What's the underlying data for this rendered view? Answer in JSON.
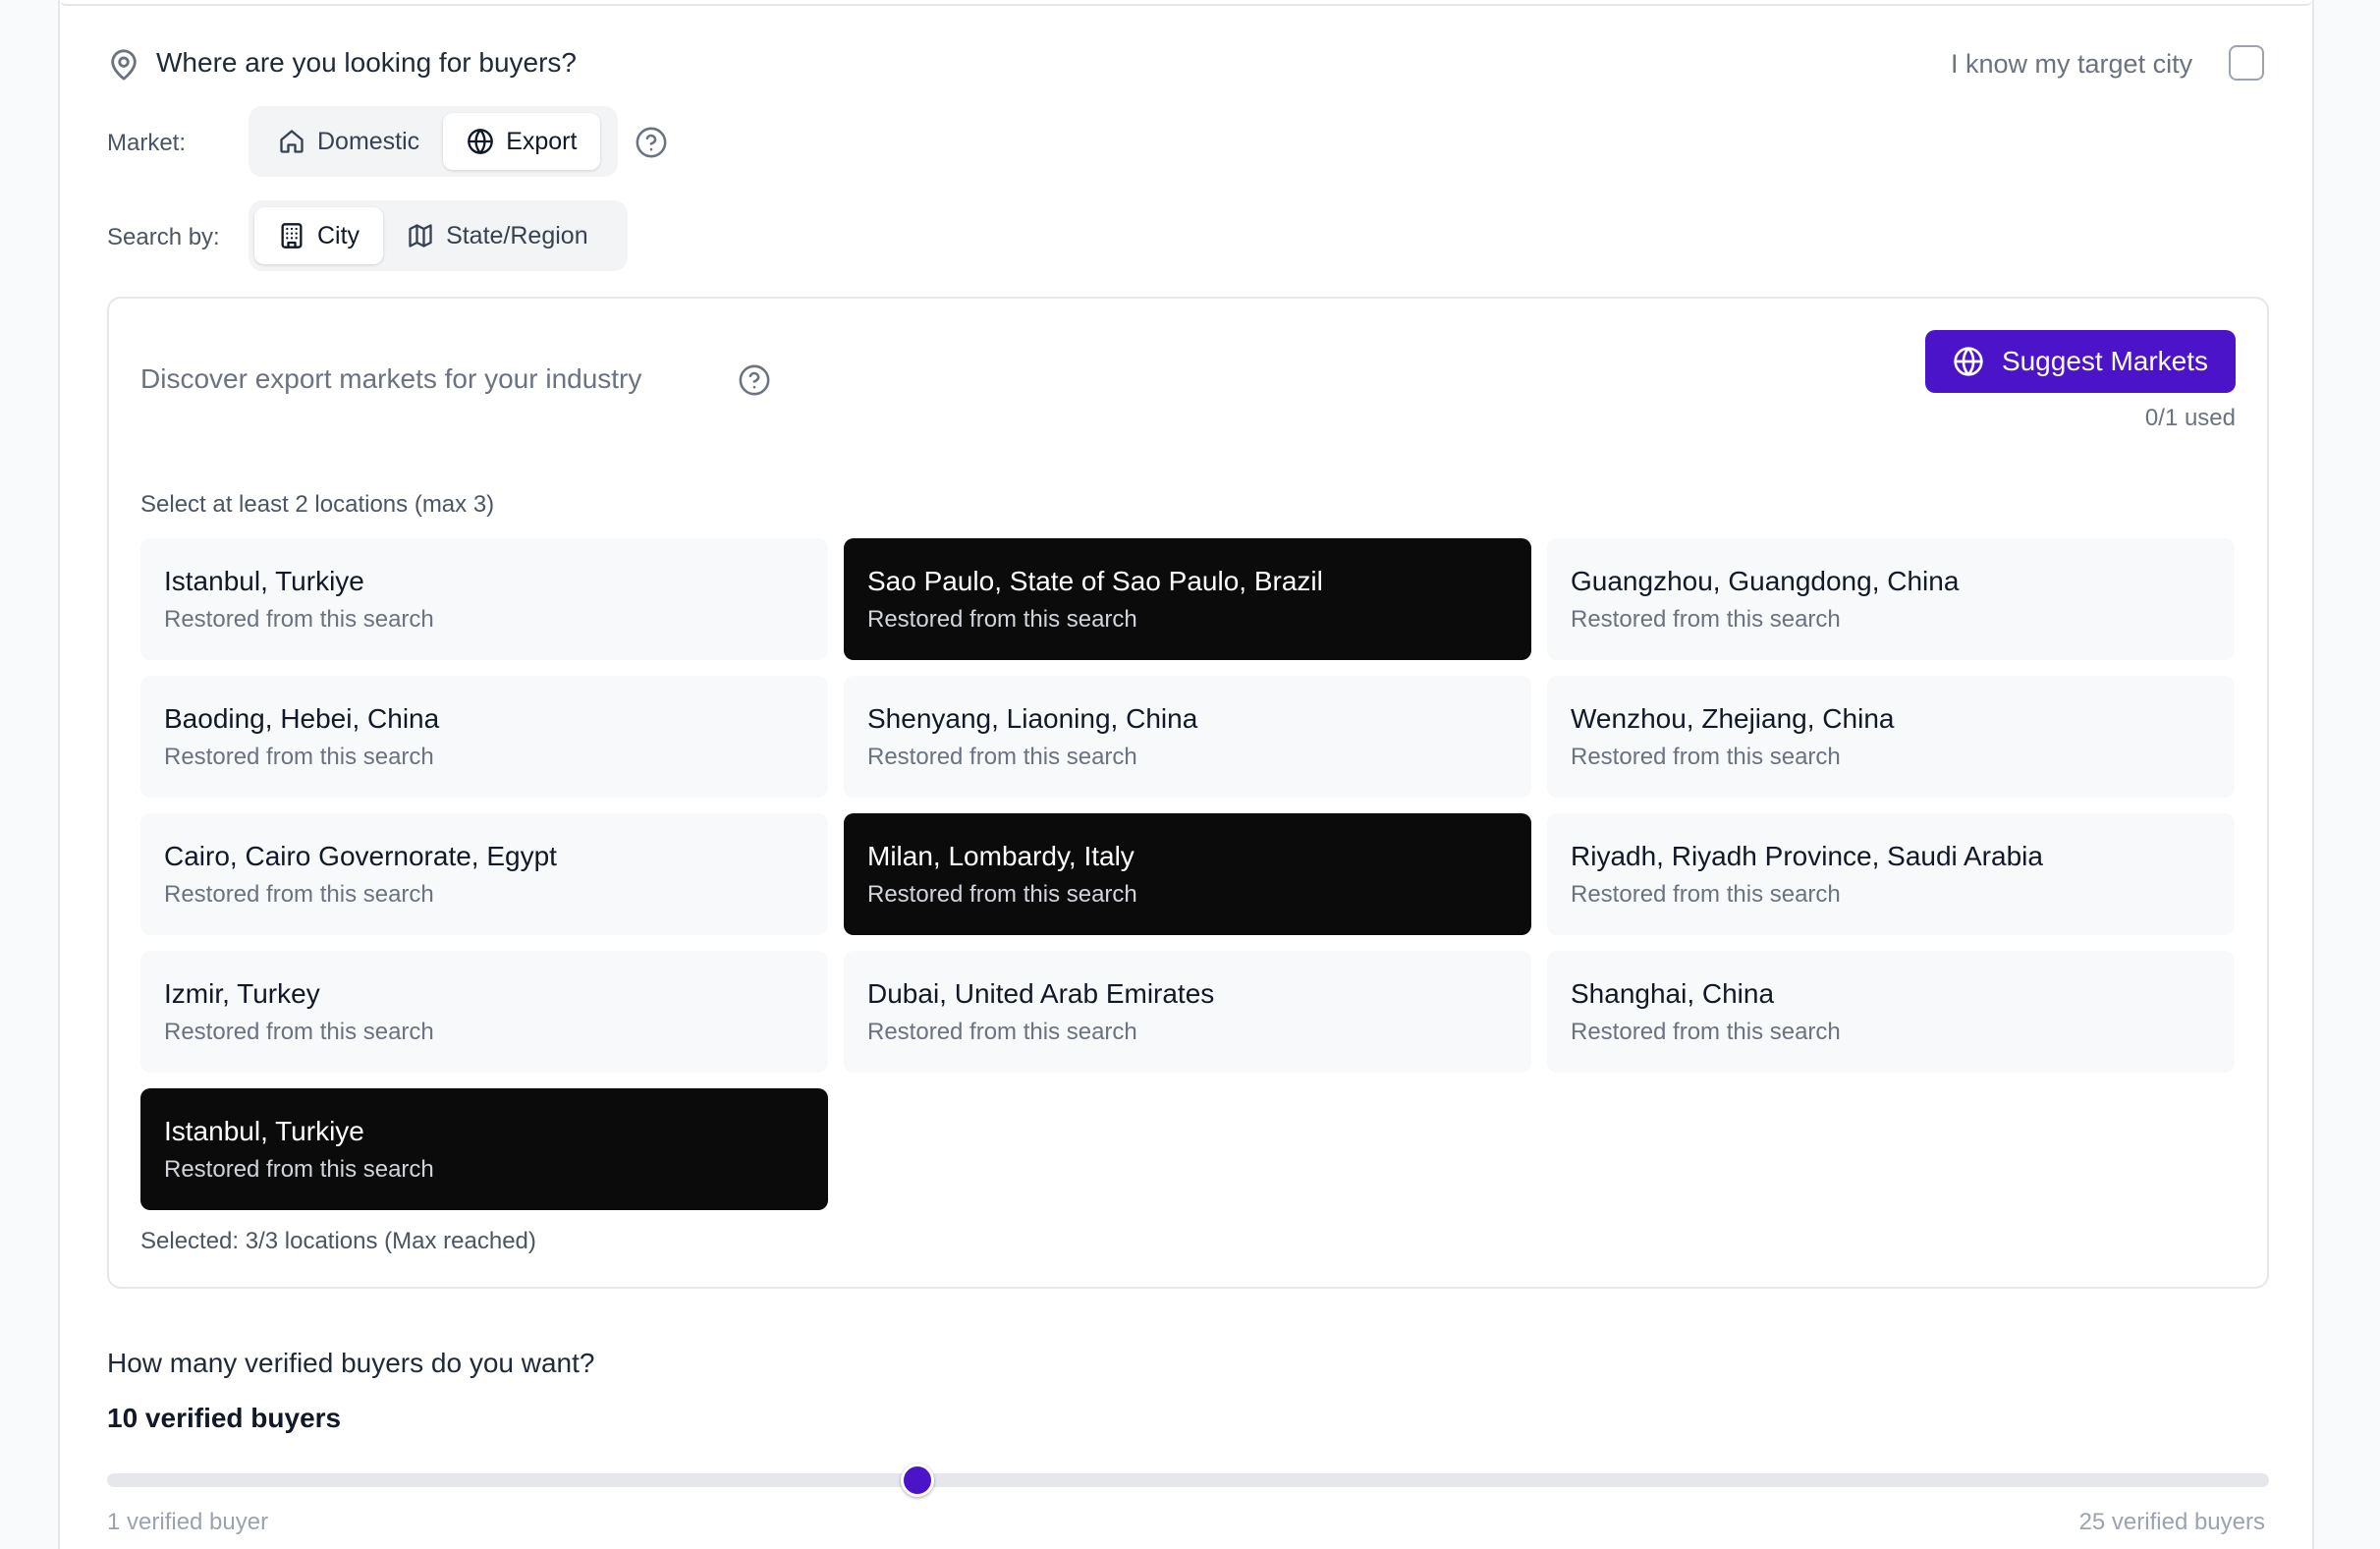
{
  "where": {
    "question": "Where are you looking for buyers?",
    "know_city_label": "I know my target city"
  },
  "market": {
    "label": "Market:",
    "options": [
      "Domestic",
      "Export"
    ],
    "selected": "Export"
  },
  "search_by": {
    "label": "Search by:",
    "options": [
      "City",
      "State/Region"
    ],
    "selected": "City"
  },
  "discover": {
    "title": "Discover export markets for your industry",
    "suggest_button": "Suggest Markets",
    "usage": "0/1 used",
    "instruction": "Select at least 2 locations (max 3)",
    "locations": [
      {
        "name": "Istanbul, Turkiye",
        "sub": "Restored from this search",
        "selected": false
      },
      {
        "name": "Sao Paulo, State of Sao Paulo, Brazil",
        "sub": "Restored from this search",
        "selected": true
      },
      {
        "name": "Guangzhou, Guangdong, China",
        "sub": "Restored from this search",
        "selected": false
      },
      {
        "name": "Baoding, Hebei, China",
        "sub": "Restored from this search",
        "selected": false
      },
      {
        "name": "Shenyang, Liaoning, China",
        "sub": "Restored from this search",
        "selected": false
      },
      {
        "name": "Wenzhou, Zhejiang, China",
        "sub": "Restored from this search",
        "selected": false
      },
      {
        "name": "Cairo, Cairo Governorate, Egypt",
        "sub": "Restored from this search",
        "selected": false
      },
      {
        "name": "Milan, Lombardy, Italy",
        "sub": "Restored from this search",
        "selected": true
      },
      {
        "name": "Riyadh, Riyadh Province, Saudi Arabia",
        "sub": "Restored from this search",
        "selected": false
      },
      {
        "name": "Izmir, Turkey",
        "sub": "Restored from this search",
        "selected": false
      },
      {
        "name": "Dubai, United Arab Emirates",
        "sub": "Restored from this search",
        "selected": false
      },
      {
        "name": "Shanghai, China",
        "sub": "Restored from this search",
        "selected": false
      },
      {
        "name": "Istanbul, Turkiye",
        "sub": "Restored from this search",
        "selected": true
      }
    ],
    "selected_summary": "Selected: 3/3 locations (Max reached)"
  },
  "buyers": {
    "question": "How many verified buyers do you want?",
    "value_label": "10 verified buyers",
    "value": 10,
    "min": 1,
    "max": 25,
    "min_label": "1 verified buyer",
    "max_label": "25 verified buyers"
  },
  "colors": {
    "accent": "#4c14c8",
    "selected_card": "#0b0b0b"
  }
}
